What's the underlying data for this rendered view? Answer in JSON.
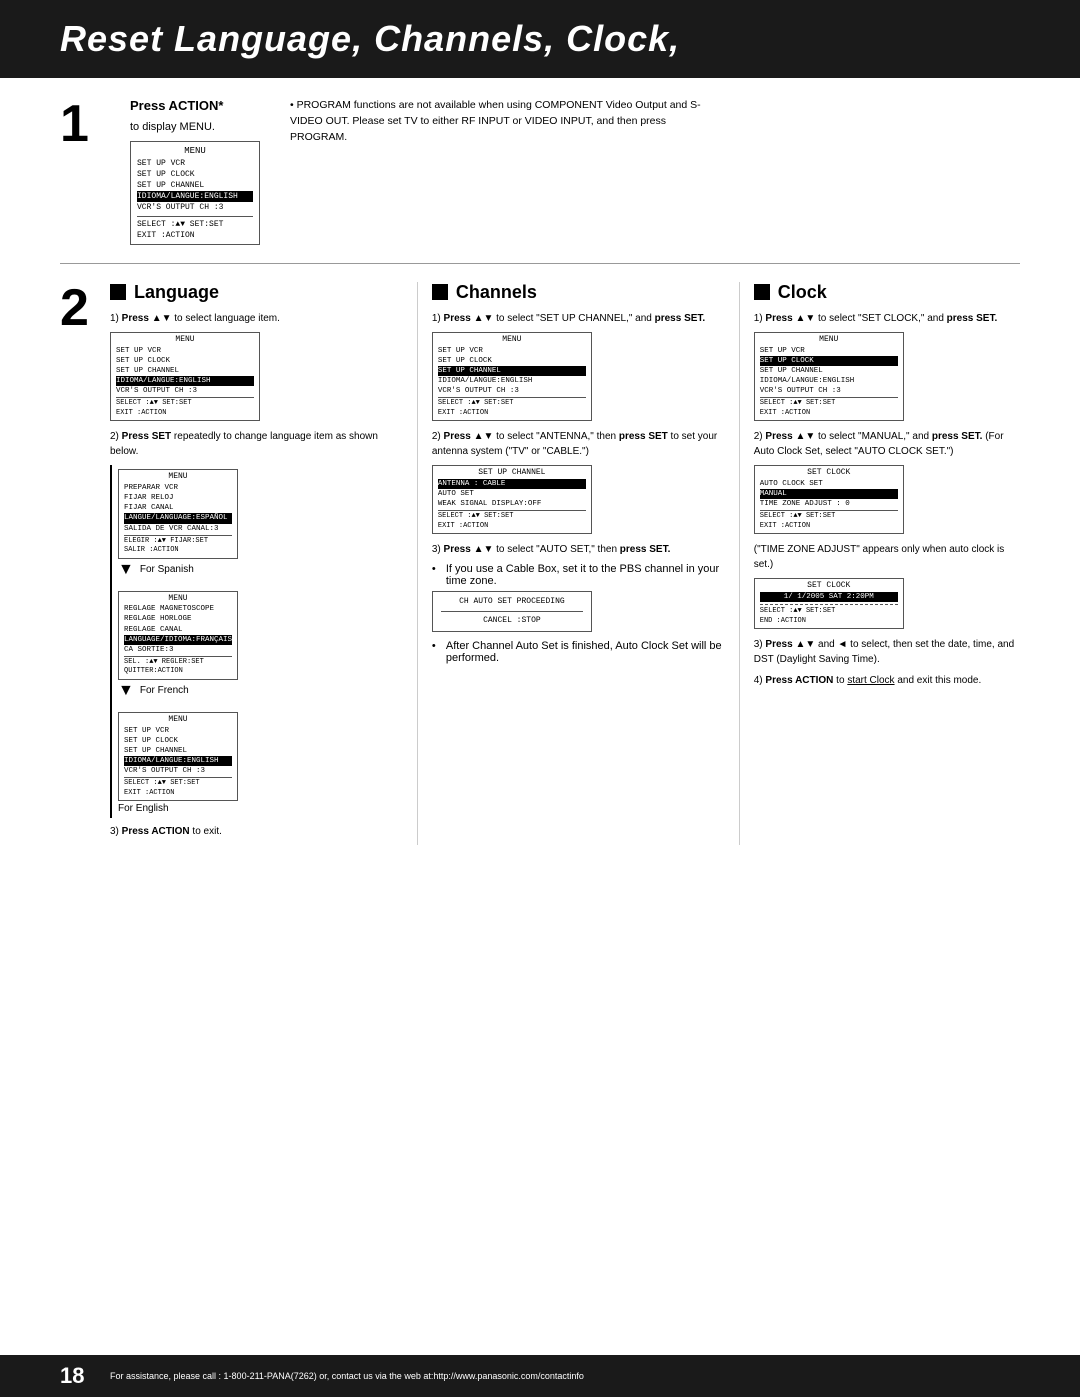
{
  "header": {
    "title": "Reset Language, Channels, Clock,"
  },
  "step1": {
    "number": "1",
    "press_action": "Press ACTION*",
    "to_display": "to display MENU.",
    "menu": {
      "title": "MENU",
      "items": [
        "SET UP VCR",
        "SET UP CLOCK",
        "SET UP CHANNEL",
        "IDIOMA/LANGUE:ENGLISH",
        "VCR'S OUTPUT CH :3"
      ],
      "footer_left": "SELECT :▲▼  SET:SET",
      "footer_right": "EXIT   :ACTION"
    },
    "note": "PROGRAM functions are not available when using COMPONENT Video Output and S-VIDEO OUT. Please set TV to either RF INPUT or VIDEO INPUT, and then press PROGRAM."
  },
  "step2": {
    "number": "2",
    "language": {
      "header": "Language",
      "step1_text": "Press ▲▼ to select language item.",
      "menu1": {
        "title": "MENU",
        "items": [
          "SET UP VCR",
          "SET UP CLOCK",
          "SET UP CHANNEL",
          "IDIOMA/LANGUE:ENGLISH",
          "VCR'S OUTPUT CH :3"
        ],
        "footer_select": "SELECT :▲▼  SET:SET",
        "footer_exit": "EXIT   :ACTION"
      },
      "step2_text": "Press SET repeatedly to change language item as shown below.",
      "spanish_menu": {
        "title": "MENU",
        "items": [
          "PREPARAR VCR",
          "FIJAR RELOJ",
          "FIJAR CANAL",
          "LANGUE/LANGUAGE:ESPAÑOL",
          "SALIDA DE VCR CANAL:3"
        ],
        "footer_select": "ELEGIR :▲▼  FIJAR:SET",
        "footer_exit": "SALIR  :ACTION"
      },
      "for_spanish": "For Spanish",
      "french_menu": {
        "title": "MENU",
        "items": [
          "REGLAGE MAGNETOSCOPE",
          "REGLAGE HORLOGE",
          "REGLAGE CANAL",
          "LANGUAGE/IDIOMA:FRANÇAIS",
          "CA SORTIE:3"
        ],
        "footer_select": "SEL.   :▲▼  REGLER:SET",
        "footer_exit": "QUITTER:ACTION"
      },
      "for_french": "For French",
      "english_menu": {
        "title": "MENU",
        "items": [
          "SET UP VCR",
          "SET UP CLOCK",
          "SET UP CHANNEL",
          "IDIOMA/LANGUE:ENGLISH",
          "VCR'S OUTPUT CH :3"
        ],
        "footer_select": "SELECT :▲▼  SET:SET",
        "footer_exit": "EXIT   :ACTION"
      },
      "for_english": "For English",
      "step3_text": "Press ACTION to exit."
    },
    "channels": {
      "header": "Channels",
      "step1_text": "Press ▲▼ to select \"SET UP CHANNEL,\" and press SET.",
      "menu1": {
        "title": "MENU",
        "items": [
          "SET UP VCR",
          "SET UP CLOCK",
          "SET UP CHANNEL",
          "IDIOMA/LANGUE:ENGLISH",
          "VCR'S OUTPUT CH :3"
        ],
        "footer_select": "SELECT :▲▼  SET:SET",
        "footer_exit": "EXIT   :ACTION"
      },
      "step2_text": "Press ▲▼ to select \"ANTENNA,\" then press SET to set your antenna system (\"TV\" or \"CABLE.\")",
      "menu2": {
        "title": "SET UP CHANNEL",
        "items": [
          "ANTENNA : CABLE",
          "AUTO SET",
          "WEAK SIGNAL DISPLAY:OFF"
        ],
        "footer_select": "SELECT :▲▼  SET:SET",
        "footer_exit": "EXIT   :ACTION"
      },
      "step3_text": "Press ▲▼ to select \"AUTO SET,\" then press SET.",
      "note1": "If you use a Cable Box, set it to the PBS channel in your time zone.",
      "auto_set_box": {
        "line1": "CH AUTO SET PROCEEDING",
        "line2": "",
        "line3": "CANCEL :STOP"
      },
      "note2": "After Channel Auto Set is finished, Auto Clock Set will be performed."
    },
    "clock": {
      "header": "Clock",
      "step1_text": "Press ▲▼ to select \"SET CLOCK,\" and press SET.",
      "menu1": {
        "title": "MENU",
        "items": [
          "SET UP VCR",
          "SET UP CLOCK",
          "SET UP CHANNEL",
          "IDIOMA/LANGUE:ENGLISH",
          "VCR'S OUTPUT CH :3"
        ],
        "footer_select": "SELECT :▲▼  SET:SET",
        "footer_exit": "EXIT   :ACTION"
      },
      "step2_text": "Press ▲▼ to select \"MANUAL,\" and press SET. (For Auto Clock Set, select \"AUTO CLOCK SET.\")",
      "menu2": {
        "title": "SET CLOCK",
        "items": [
          "AUTO CLOCK SET",
          "MANUAL",
          "TIME ZONE ADJUST : 0"
        ],
        "footer_select": "SELECT :▲▼  SET:SET",
        "footer_exit": "EXIT   :ACTION"
      },
      "tz_note": "(\"TIME ZONE ADJUST\" appears only when auto clock is set.)",
      "date_menu": {
        "title": "SET CLOCK",
        "date_line": "1/ 1/2005 SAT 2:20PM",
        "footer_select": "SELECT :▲▼  SET:SET",
        "footer_exit": "END    :ACTION"
      },
      "step3_text": "Press ▲▼ and ◄ to select, then set the date, time, and DST (Daylight Saving Time).",
      "step4_text": "Press ACTION to start Clock and exit this mode."
    }
  },
  "footer": {
    "page_number": "18",
    "support_text": "For assistance, please call : 1-800-211-PANA(7262) or, contact us via the web at:http://www.panasonic.com/contactinfo"
  }
}
